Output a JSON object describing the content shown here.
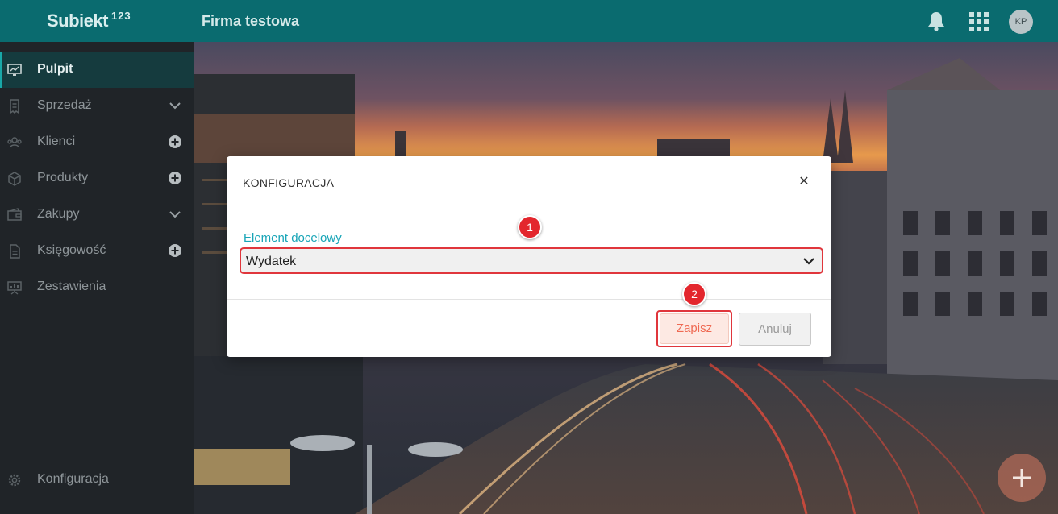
{
  "app": {
    "logo_text": "Subiekt",
    "logo_suffix": "123",
    "company": "Firma testowa",
    "avatar_initials": "KP"
  },
  "sidebar": {
    "items": [
      {
        "label": "Pulpit",
        "icon": "desktop-icon",
        "aside": null,
        "active": true
      },
      {
        "label": "Sprzedaż",
        "icon": "receipt-icon",
        "aside": "chevron-down-icon",
        "active": false
      },
      {
        "label": "Klienci",
        "icon": "users-icon",
        "aside": "plus-circle-icon",
        "active": false
      },
      {
        "label": "Produkty",
        "icon": "box-icon",
        "aside": "plus-circle-icon",
        "active": false
      },
      {
        "label": "Zakupy",
        "icon": "wallet-icon",
        "aside": "chevron-down-icon",
        "active": false
      },
      {
        "label": "Księgowość",
        "icon": "document-icon",
        "aside": "plus-circle-icon",
        "active": false
      },
      {
        "label": "Zestawienia",
        "icon": "presentation-icon",
        "aside": null,
        "active": false
      }
    ],
    "settings_label": "Konfiguracja"
  },
  "modal": {
    "title": "KONFIGURACJA",
    "close_icon": "close-icon",
    "field_label": "Element docelowy",
    "select_value": "Wydatek",
    "save_label": "Zapisz",
    "cancel_label": "Anuluj"
  },
  "annotations": {
    "badge1": "1",
    "badge2": "2"
  },
  "colors": {
    "topbar": "#0a6b6f",
    "sidebar": "#202428",
    "accent": "#18a5b7",
    "highlight": "#e0363c",
    "save_text": "#ef6a53"
  }
}
